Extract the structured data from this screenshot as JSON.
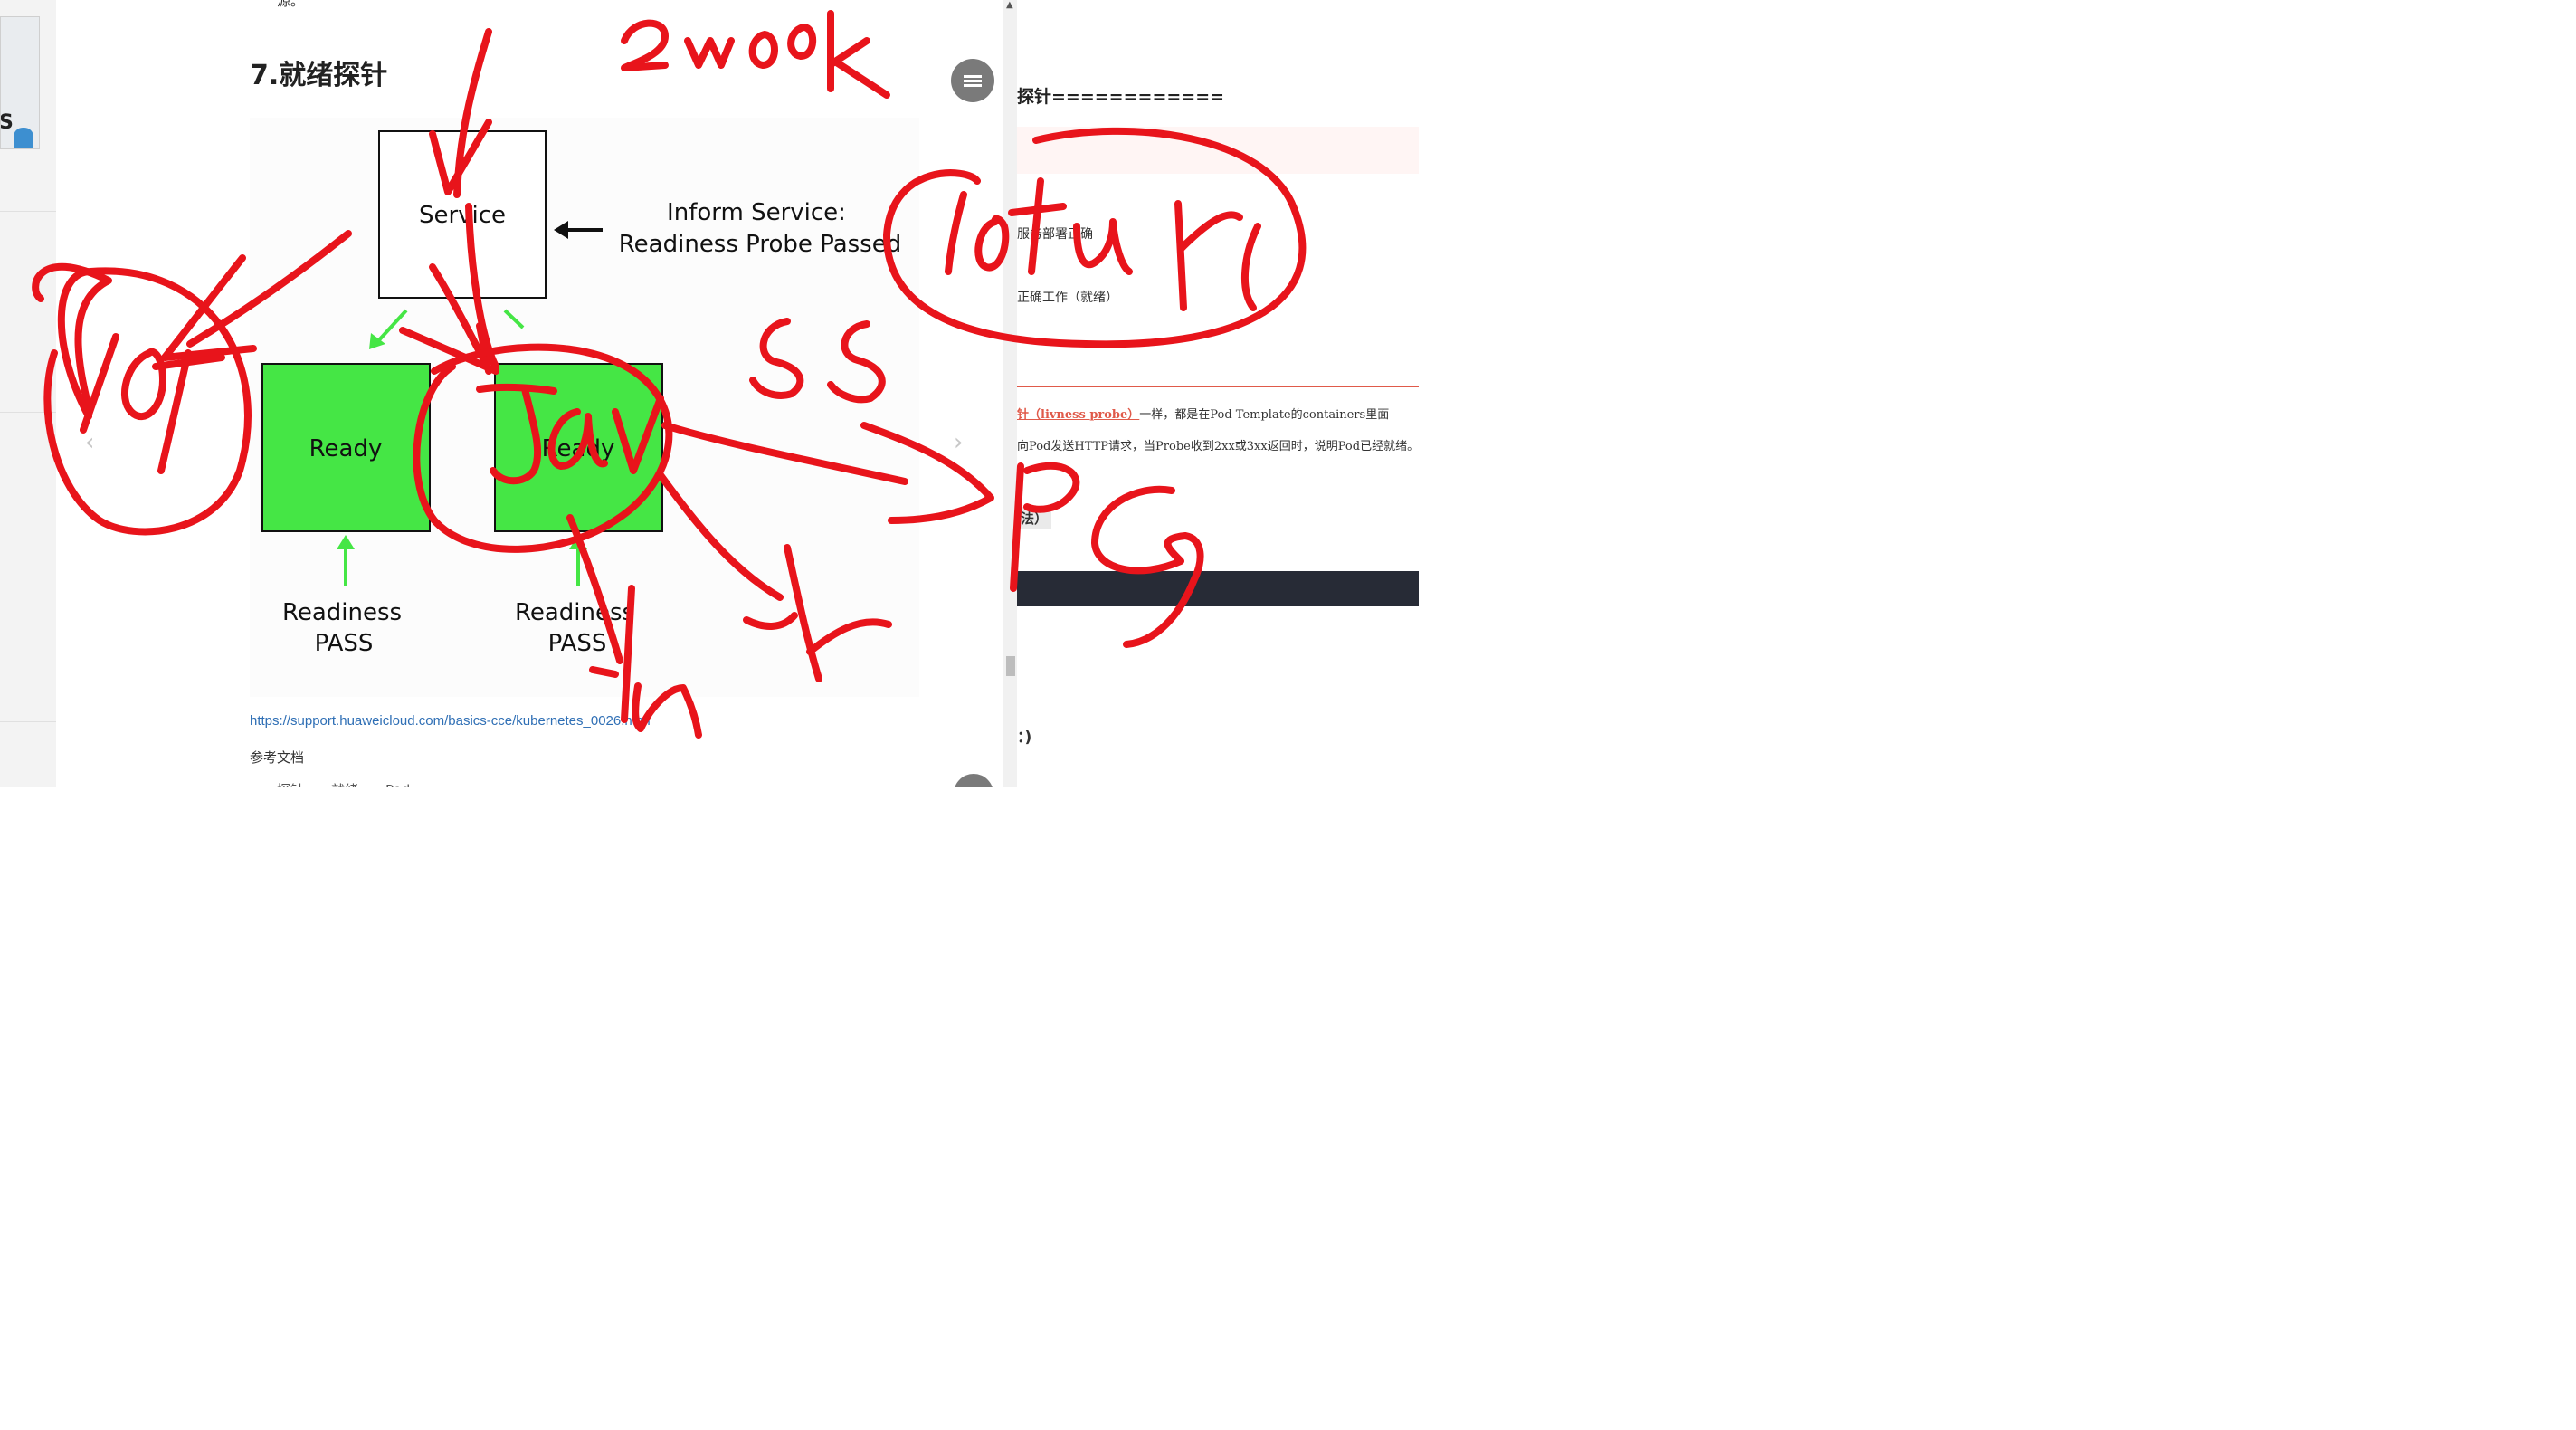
{
  "article": {
    "top_char": "源。",
    "heading": "7.就绪探针",
    "ref_link": "https://support.huaweicloud.com/basics-cce/kubernetes_0026.html",
    "ref_doc": "参考文档",
    "cut_text": "……探针……就绪……Pod……"
  },
  "diagram": {
    "service_label": "Service",
    "inform_line1": "Inform Service:",
    "inform_line2": "Readiness Probe Passed",
    "pod1_label": "Ready",
    "pod2_label": "Ready",
    "probe1_line1": "Readiness",
    "probe1_line2": "PASS",
    "probe2_line1": "Readiness",
    "probe2_line2": "PASS",
    "colors": {
      "pod_fill": "#45e645",
      "arrow_green": "#45e645",
      "border": "#111111"
    }
  },
  "right_pane": {
    "heading": "探针============",
    "line1": "服务部署正确",
    "line2": "正确工作（就绪）",
    "para1_highlight": "针（livness probe）",
    "para1_rest": "一样，都是在Pod Template的containers里面",
    "para2": "向Pod发送HTTP请求，当Probe收到2xx或3xx返回时，说明Pod已经就绪。",
    "sub1": "法）",
    "sub2": "：)"
  },
  "ink": {
    "color": "#e8141b"
  },
  "icons": {
    "menu": "menu-icon",
    "prev": "chevron-left-icon",
    "next": "chevron-right-icon",
    "scroll_up": "scroll-up-arrow-icon"
  }
}
